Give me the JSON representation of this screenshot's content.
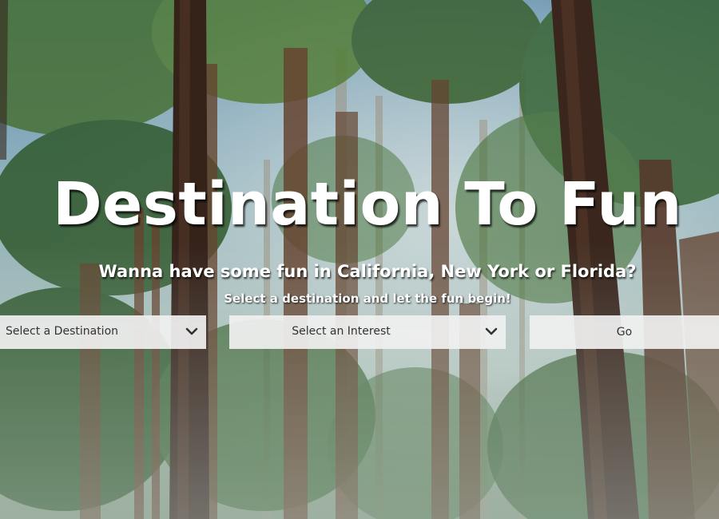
{
  "hero": {
    "title": "Destination To Fun",
    "subtitle": "Wanna have some fun in California, New York or Florida?",
    "tagline": "Select a destination and let the fun begin!"
  },
  "form": {
    "destination_select": {
      "selected": "Select a Destination",
      "icon": "chevron-down-icon"
    },
    "interest_select": {
      "selected": "Select an Interest",
      "icon": "chevron-down-icon"
    },
    "go_label": "Go"
  },
  "colors": {
    "text": "#ffffff",
    "control_bg": "#f0f0f0",
    "control_text": "#333333"
  }
}
